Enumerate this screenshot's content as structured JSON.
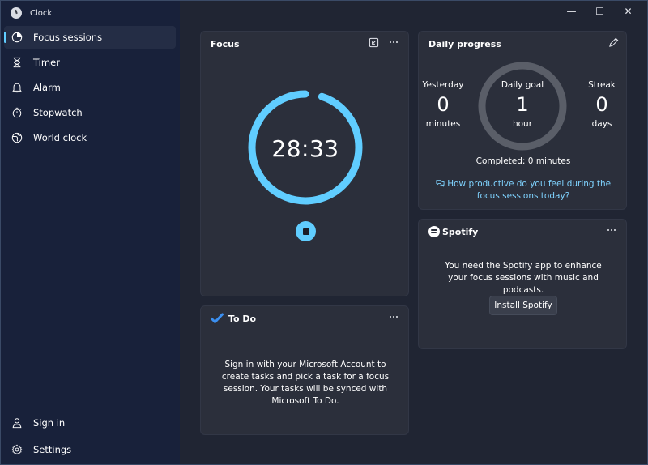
{
  "app": {
    "title": "Clock"
  },
  "window_controls": {
    "minimize": "—",
    "maximize": "☐",
    "close": "✕"
  },
  "sidebar": {
    "items": [
      {
        "label": "Focus sessions",
        "icon": "focus-icon",
        "active": true
      },
      {
        "label": "Timer",
        "icon": "hourglass-icon"
      },
      {
        "label": "Alarm",
        "icon": "bell-icon"
      },
      {
        "label": "Stopwatch",
        "icon": "stopwatch-icon"
      },
      {
        "label": "World clock",
        "icon": "globe-icon"
      }
    ],
    "bottom": [
      {
        "label": "Sign in",
        "icon": "person-icon"
      },
      {
        "label": "Settings",
        "icon": "gear-icon"
      }
    ]
  },
  "focus": {
    "title": "Focus",
    "time": "28:33",
    "progress_fraction": 0.95,
    "accent": "#60cdff"
  },
  "progress": {
    "title": "Daily progress",
    "yesterday": {
      "label": "Yesterday",
      "value": "0",
      "unit": "minutes"
    },
    "goal": {
      "label": "Daily goal",
      "value": "1",
      "unit": "hour"
    },
    "streak": {
      "label": "Streak",
      "value": "0",
      "unit": "days"
    },
    "completed": "Completed: 0 minutes",
    "feedback": "How productive do you feel during the focus sessions today?"
  },
  "spotify": {
    "brand": "Spotify",
    "message": "You need the Spotify app to enhance your focus sessions with music and podcasts.",
    "install_label": "Install Spotify"
  },
  "todo": {
    "title": "To Do",
    "message": "Sign in with your Microsoft Account to create tasks and pick a task for a focus session. Your tasks will be synced with Microsoft To Do."
  }
}
